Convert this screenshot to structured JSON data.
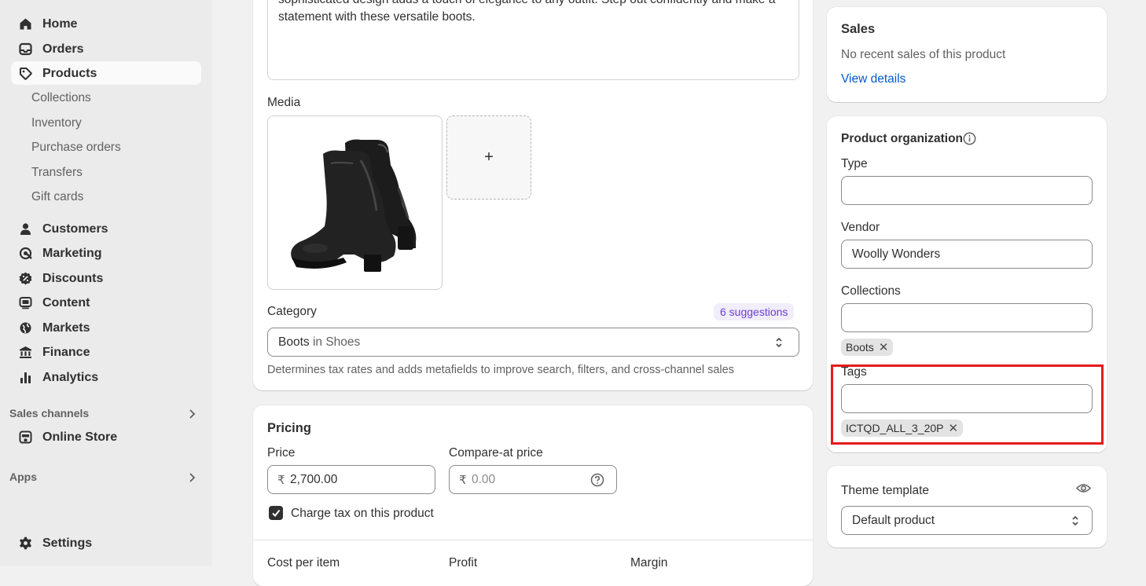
{
  "sidebar": {
    "items": [
      {
        "label": "Home",
        "icon": "home-icon"
      },
      {
        "label": "Orders",
        "icon": "inbox-icon"
      },
      {
        "label": "Products",
        "icon": "tag-icon"
      },
      {
        "label": "Customers",
        "icon": "person-icon"
      },
      {
        "label": "Marketing",
        "icon": "target-icon"
      },
      {
        "label": "Discounts",
        "icon": "discount-icon"
      },
      {
        "label": "Content",
        "icon": "content-icon"
      },
      {
        "label": "Markets",
        "icon": "globe-icon"
      },
      {
        "label": "Finance",
        "icon": "bank-icon"
      },
      {
        "label": "Analytics",
        "icon": "bar-chart-icon"
      }
    ],
    "product_sub": [
      "Collections",
      "Inventory",
      "Purchase orders",
      "Transfers",
      "Gift cards"
    ],
    "sales_channels_label": "Sales channels",
    "online_store_label": "Online Store",
    "apps_label": "Apps",
    "settings_label": "Settings"
  },
  "description": {
    "line1": "sophisticated design adds a touch of elegance to any outfit. Step out confidently and make a",
    "line2": "statement with these versatile boots."
  },
  "media": {
    "label": "Media",
    "add_symbol": "+"
  },
  "category": {
    "label": "Category",
    "suggestions": "6 suggestions",
    "value_main": "Boots",
    "value_rest": " in Shoes",
    "help": "Determines tax rates and adds metafields to improve search, filters, and cross-channel sales"
  },
  "pricing": {
    "title": "Pricing",
    "price_label": "Price",
    "currency": "₹",
    "price_value": "2,700.00",
    "compare_label": "Compare-at price",
    "compare_placeholder": "0.00",
    "charge_tax_label": "Charge tax on this product",
    "charge_tax_checked": true,
    "cost_label": "Cost per item",
    "profit_label": "Profit",
    "margin_label": "Margin"
  },
  "sales": {
    "title": "Sales",
    "text": "No recent sales of this product",
    "link": "View details"
  },
  "organization": {
    "title": "Product organization",
    "type_label": "Type",
    "type_value": "",
    "vendor_label": "Vendor",
    "vendor_value": "Woolly Wonders",
    "collections_label": "Collections",
    "collections_value": "",
    "collection_chips": [
      "Boots"
    ],
    "tags_label": "Tags",
    "tags_value": "",
    "tag_chips": [
      "ICTQD_ALL_3_20P"
    ]
  },
  "theme": {
    "title": "Theme template",
    "value": "Default product"
  },
  "colors": {
    "accent_link": "#005bd3",
    "suggestion_text": "#6b3fd1",
    "highlight_box": "#e51c1c"
  }
}
